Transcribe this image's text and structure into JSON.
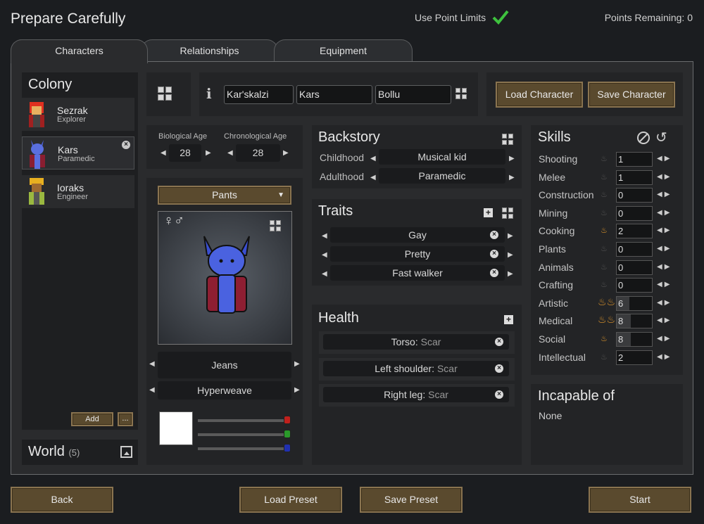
{
  "app": {
    "title": "Prepare Carefully",
    "use_point_limits": "Use Point Limits",
    "points_remaining": "Points Remaining: 0"
  },
  "tabs": [
    "Characters",
    "Relationships",
    "Equipment"
  ],
  "colony": {
    "title": "Colony",
    "characters": [
      {
        "name": "Sezrak",
        "role": "Explorer"
      },
      {
        "name": "Kars",
        "role": "Paramedic"
      },
      {
        "name": "Ioraks",
        "role": "Engineer"
      }
    ],
    "add": "Add",
    "more": "..."
  },
  "world": {
    "title": "World",
    "count": "(5)"
  },
  "name": {
    "first": "Kar'skalzi",
    "nick": "Kars",
    "last": "Bollu"
  },
  "buttons": {
    "load_character": "Load Character",
    "save_character": "Save Character",
    "back": "Back",
    "load_preset": "Load Preset",
    "save_preset": "Save Preset",
    "start": "Start"
  },
  "age": {
    "bio_label": "Biological Age",
    "bio": "28",
    "chrono_label": "Chronological Age",
    "chrono": "28"
  },
  "apparel": {
    "layer": "Pants",
    "gender_symbols": "♀♂",
    "item": "Jeans",
    "material": "Hyperweave",
    "color": "#ffffff",
    "rgb_colors": [
      "#c0201c",
      "#2a9a2a",
      "#2030b0"
    ]
  },
  "backstory": {
    "title": "Backstory",
    "childhood_label": "Childhood",
    "childhood": "Musical kid",
    "adulthood_label": "Adulthood",
    "adulthood": "Paramedic"
  },
  "traits": {
    "title": "Traits",
    "items": [
      "Gay",
      "Pretty",
      "Fast walker"
    ]
  },
  "health": {
    "title": "Health",
    "items": [
      {
        "part": "Torso:",
        "cond": "Scar"
      },
      {
        "part": "Left shoulder:",
        "cond": "Scar"
      },
      {
        "part": "Right leg:",
        "cond": "Scar"
      }
    ]
  },
  "skills": {
    "title": "Skills",
    "items": [
      {
        "name": "Shooting",
        "value": "1",
        "passion": 0,
        "level": 0
      },
      {
        "name": "Melee",
        "value": "1",
        "passion": 0,
        "level": 0
      },
      {
        "name": "Construction",
        "value": "0",
        "passion": 0,
        "level": 0
      },
      {
        "name": "Mining",
        "value": "0",
        "passion": 0,
        "level": 0
      },
      {
        "name": "Cooking",
        "value": "2",
        "passion": 1,
        "level": 0
      },
      {
        "name": "Plants",
        "value": "0",
        "passion": 0,
        "level": 0
      },
      {
        "name": "Animals",
        "value": "0",
        "passion": 0,
        "level": 0
      },
      {
        "name": "Crafting",
        "value": "0",
        "passion": 0,
        "level": 0
      },
      {
        "name": "Artistic",
        "value": "6",
        "passion": 2,
        "level": 0.35
      },
      {
        "name": "Medical",
        "value": "8",
        "passion": 2,
        "level": 0.4
      },
      {
        "name": "Social",
        "value": "8",
        "passion": 1,
        "level": 0.4
      },
      {
        "name": "Intellectual",
        "value": "2",
        "passion": 0,
        "level": 0
      }
    ]
  },
  "incapable": {
    "title": "Incapable of",
    "value": "None"
  }
}
